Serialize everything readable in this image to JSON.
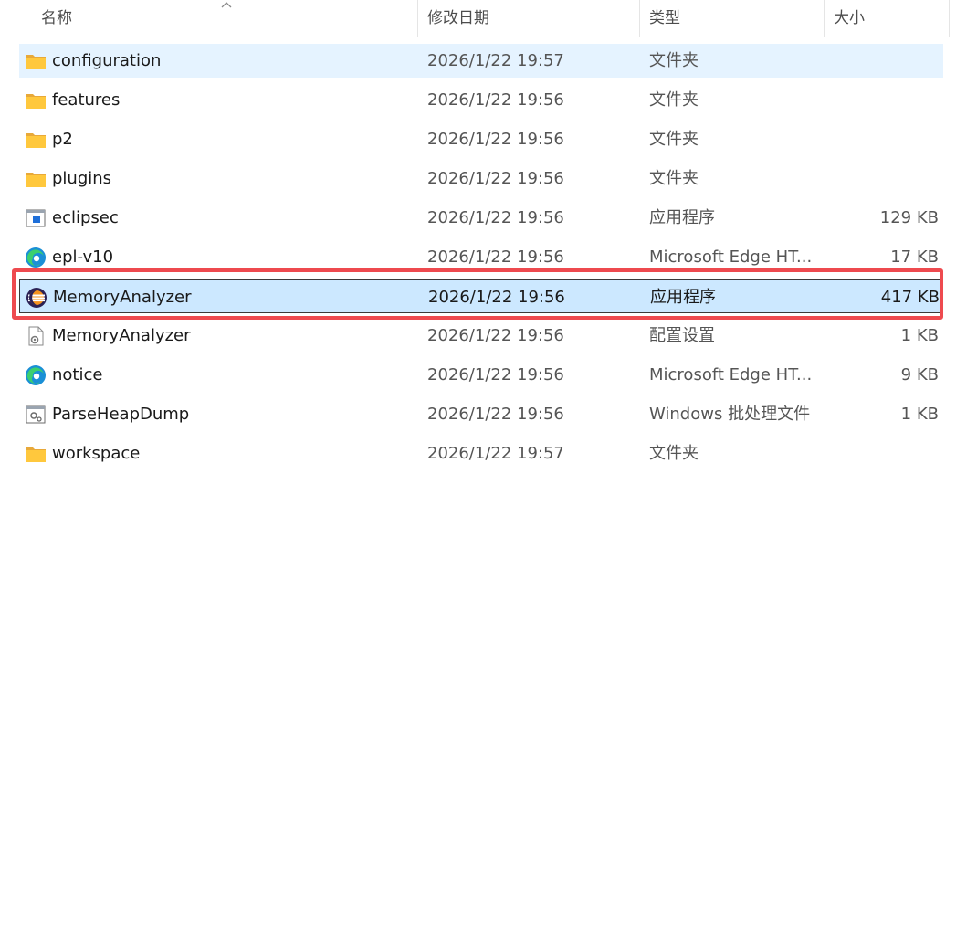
{
  "columns": {
    "name": "名称",
    "date": "修改日期",
    "type": "类型",
    "size": "大小"
  },
  "rows": [
    {
      "name": "configuration",
      "date": "2026/1/22 19:57",
      "type": "文件夹",
      "size": "",
      "icon": "folder-icon"
    },
    {
      "name": "features",
      "date": "2026/1/22 19:56",
      "type": "文件夹",
      "size": "",
      "icon": "folder-icon"
    },
    {
      "name": "p2",
      "date": "2026/1/22 19:56",
      "type": "文件夹",
      "size": "",
      "icon": "folder-icon"
    },
    {
      "name": "plugins",
      "date": "2026/1/22 19:56",
      "type": "文件夹",
      "size": "",
      "icon": "folder-icon"
    },
    {
      "name": "eclipsec",
      "date": "2026/1/22 19:56",
      "type": "应用程序",
      "size": "129 KB",
      "icon": "application-icon"
    },
    {
      "name": "epl-v10",
      "date": "2026/1/22 19:56",
      "type": "Microsoft Edge HT...",
      "size": "17 KB",
      "icon": "edge-icon"
    },
    {
      "name": "MemoryAnalyzer",
      "date": "2026/1/22 19:56",
      "type": "应用程序",
      "size": "417 KB",
      "icon": "eclipse-icon"
    },
    {
      "name": "MemoryAnalyzer",
      "date": "2026/1/22 19:56",
      "type": "配置设置",
      "size": "1 KB",
      "icon": "config-file-icon"
    },
    {
      "name": "notice",
      "date": "2026/1/22 19:56",
      "type": "Microsoft Edge HT...",
      "size": "9 KB",
      "icon": "edge-icon"
    },
    {
      "name": "ParseHeapDump",
      "date": "2026/1/22 19:56",
      "type": "Windows 批处理文件",
      "size": "1 KB",
      "icon": "batch-file-icon"
    },
    {
      "name": "workspace",
      "date": "2026/1/22 19:57",
      "type": "文件夹",
      "size": "",
      "icon": "folder-icon"
    }
  ],
  "colors": {
    "hover_row": "#e5f3ff",
    "selected_row": "#cce8ff",
    "annotation_border": "#ee4a4f",
    "folder": "#ffc83d"
  }
}
